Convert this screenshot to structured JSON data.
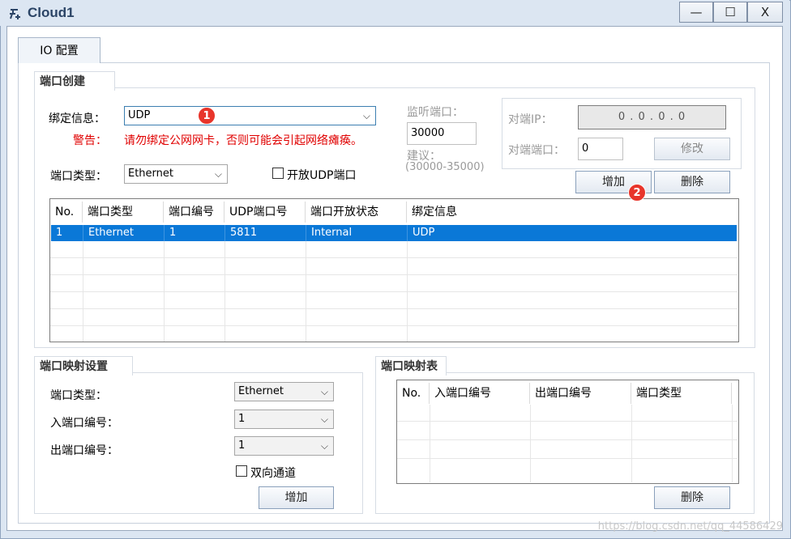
{
  "window": {
    "title": "Cloud1",
    "minimize": "—",
    "maximize": "☐",
    "close": "X"
  },
  "tab": {
    "label": "IO 配置"
  },
  "port_create": {
    "title": "端口创建",
    "bind_label": "绑定信息：",
    "bind_value": "UDP",
    "warning_label": "警告：",
    "warning_text": "请勿绑定公网网卡，否则可能会引起网络瘫痪。",
    "port_type_label": "端口类型：",
    "port_type_value": "Ethernet",
    "open_udp_label": "开放UDP端口",
    "listen_label": "监听端口：",
    "listen_value": "30000",
    "suggest_label": "建议：",
    "suggest_range": "(30000-35000)",
    "peer_ip_label": "对端IP：",
    "peer_ip_value": "0 . 0 . 0 . 0",
    "peer_port_label": "对端端口：",
    "peer_port_value": "0",
    "modify_label": "修改",
    "add_label": "增加",
    "delete_label": "删除",
    "table": {
      "headers": [
        "No.",
        "端口类型",
        "端口编号",
        "UDP端口号",
        "端口开放状态",
        "绑定信息"
      ],
      "rows": [
        [
          "1",
          "Ethernet",
          "1",
          "5811",
          "Internal",
          "UDP"
        ]
      ]
    }
  },
  "port_map": {
    "title": "端口映射设置",
    "type_label": "端口类型：",
    "type_value": "Ethernet",
    "in_label": "入端口编号：",
    "in_value": "1",
    "out_label": "出端口编号：",
    "out_value": "1",
    "bidir_label": "双向通道",
    "add_label": "增加"
  },
  "map_table": {
    "title": "端口映射表",
    "headers": [
      "No.",
      "入端口编号",
      "出端口编号",
      "端口类型"
    ],
    "delete_label": "删除"
  },
  "badges": [
    "1",
    "2"
  ],
  "watermark": "https://blog.csdn.net/qq_44586429",
  "colors": {
    "accent": "#0a78d7",
    "warning": "#e00000",
    "badge": "#e8352b"
  }
}
